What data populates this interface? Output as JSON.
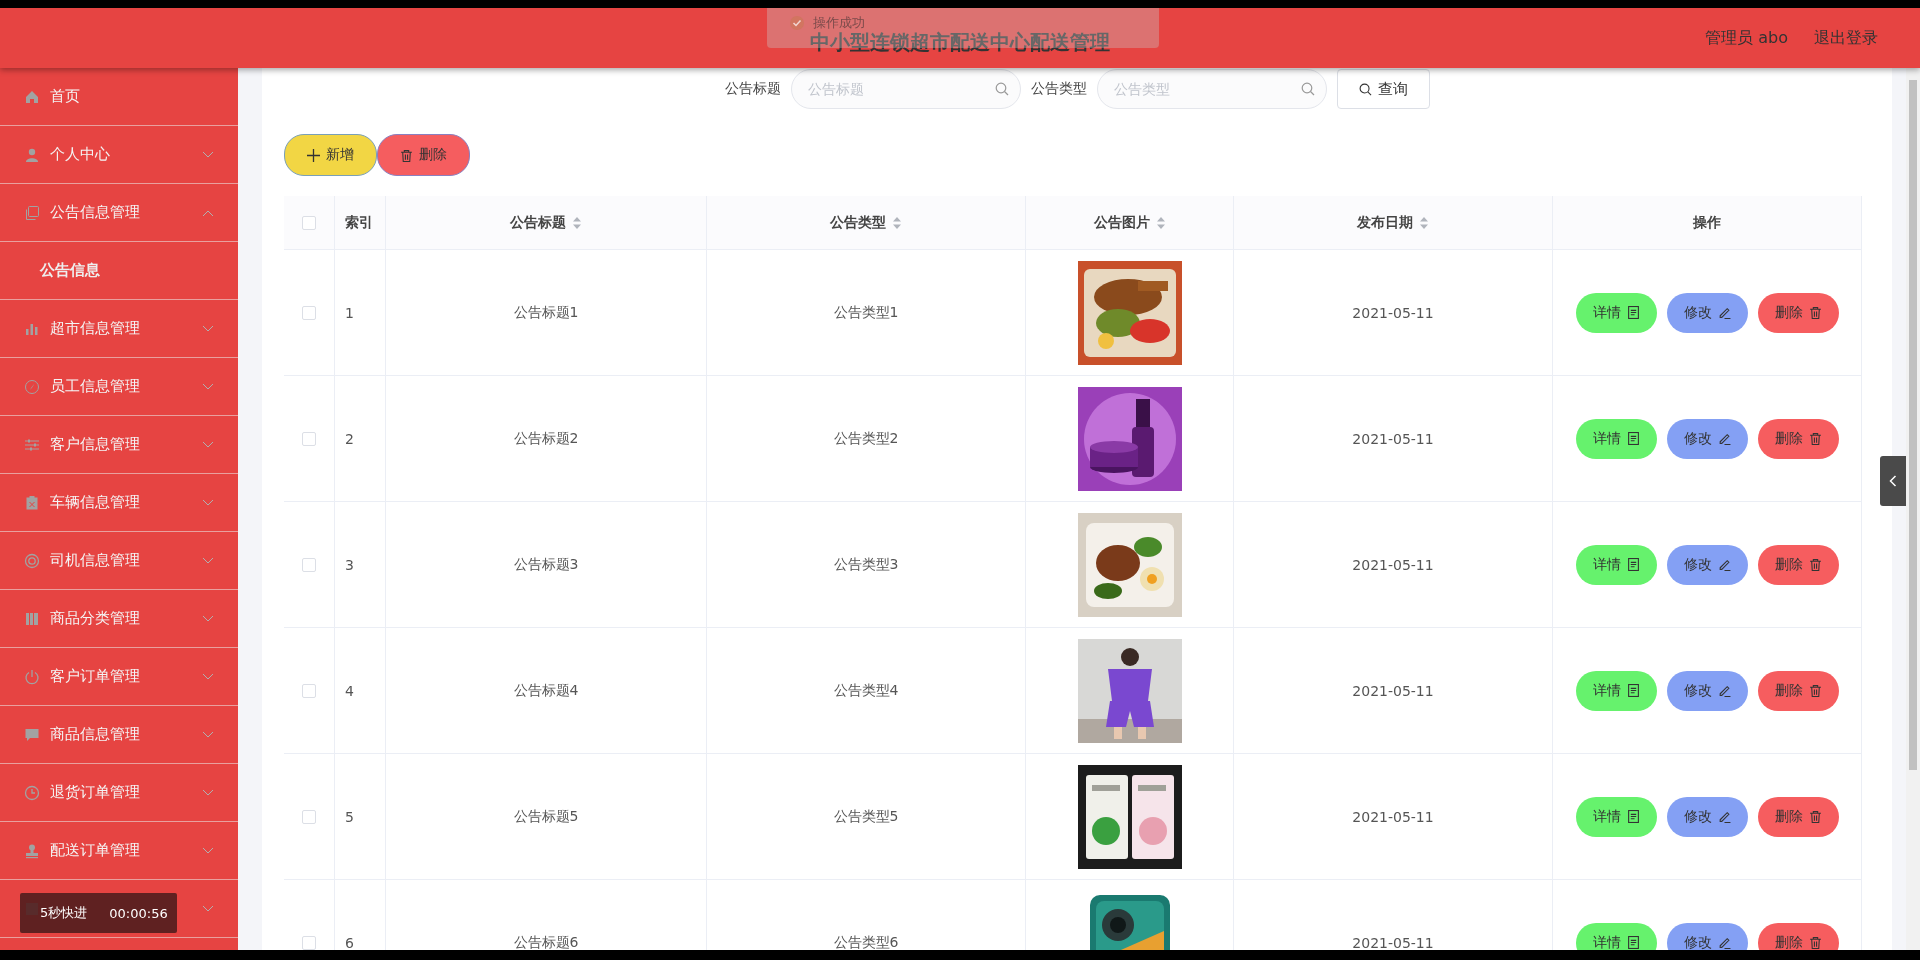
{
  "header": {
    "title": "中小型连锁超市配送中心配送管理",
    "user": "管理员 abo",
    "logout": "退出登录"
  },
  "toast": {
    "text": "操作成功"
  },
  "sidebar": {
    "items": [
      {
        "label": "首页",
        "kind": "link"
      },
      {
        "label": "个人中心",
        "kind": "submenu",
        "expanded": false
      },
      {
        "label": "公告信息管理",
        "kind": "submenu",
        "expanded": true,
        "children": [
          {
            "label": "公告信息",
            "selected": true
          }
        ]
      },
      {
        "label": "超市信息管理",
        "kind": "submenu",
        "expanded": false
      },
      {
        "label": "员工信息管理",
        "kind": "submenu",
        "expanded": false
      },
      {
        "label": "客户信息管理",
        "kind": "submenu",
        "expanded": false
      },
      {
        "label": "车辆信息管理",
        "kind": "submenu",
        "expanded": false
      },
      {
        "label": "司机信息管理",
        "kind": "submenu",
        "expanded": false
      },
      {
        "label": "商品分类管理",
        "kind": "submenu",
        "expanded": false
      },
      {
        "label": "客户订单管理",
        "kind": "submenu",
        "expanded": false
      },
      {
        "label": "商品信息管理",
        "kind": "submenu",
        "expanded": false
      },
      {
        "label": "退货订单管理",
        "kind": "submenu",
        "expanded": false
      },
      {
        "label": "配送订单管理",
        "kind": "submenu",
        "expanded": false
      },
      {
        "kind": "submenu",
        "expanded": false
      }
    ]
  },
  "search": {
    "fields": [
      {
        "label": "公告标题",
        "placeholder": "公告标题"
      },
      {
        "label": "公告类型",
        "placeholder": "公告类型"
      }
    ],
    "button": "查询"
  },
  "actions": [
    {
      "label": "新增",
      "kind": "add"
    },
    {
      "label": "删除",
      "kind": "delete"
    }
  ],
  "table": {
    "select_all": {
      "checked": false
    },
    "columns": [
      {
        "label": "索引",
        "sortable": false
      },
      {
        "label": "公告标题",
        "sortable": true
      },
      {
        "label": "公告类型",
        "sortable": true
      },
      {
        "label": "公告图片",
        "sortable": true
      },
      {
        "label": "发布日期",
        "sortable": true
      },
      {
        "label": "操作",
        "sortable": false
      }
    ],
    "rows": [
      {
        "checked": false,
        "index": "1",
        "title": "公告标题1",
        "type": "公告类型1",
        "date": "2021-05-11",
        "buttons": [
          {
            "label": "详情",
            "kind": "detail"
          },
          {
            "label": "修改",
            "kind": "edit"
          },
          {
            "label": "删除",
            "kind": "delete"
          }
        ]
      },
      {
        "checked": false,
        "index": "2",
        "title": "公告标题2",
        "type": "公告类型2",
        "date": "2021-05-11",
        "buttons": [
          {
            "label": "详情",
            "kind": "detail"
          },
          {
            "label": "修改",
            "kind": "edit"
          },
          {
            "label": "删除",
            "kind": "delete"
          }
        ]
      },
      {
        "checked": false,
        "index": "3",
        "title": "公告标题3",
        "type": "公告类型3",
        "date": "2021-05-11",
        "buttons": [
          {
            "label": "详情",
            "kind": "detail"
          },
          {
            "label": "修改",
            "kind": "edit"
          },
          {
            "label": "删除",
            "kind": "delete"
          }
        ]
      },
      {
        "checked": false,
        "index": "4",
        "title": "公告标题4",
        "type": "公告类型4",
        "date": "2021-05-11",
        "buttons": [
          {
            "label": "详情",
            "kind": "detail"
          },
          {
            "label": "修改",
            "kind": "edit"
          },
          {
            "label": "删除",
            "kind": "delete"
          }
        ]
      },
      {
        "checked": false,
        "index": "5",
        "title": "公告标题5",
        "type": "公告类型5",
        "date": "2021-05-11",
        "buttons": [
          {
            "label": "详情",
            "kind": "detail"
          },
          {
            "label": "修改",
            "kind": "edit"
          },
          {
            "label": "删除",
            "kind": "delete"
          }
        ]
      },
      {
        "checked": false,
        "index": "6",
        "title": "公告标题6",
        "type": "公告类型6",
        "date": "2021-05-11",
        "buttons": [
          {
            "label": "详情",
            "kind": "detail"
          },
          {
            "label": "修改",
            "kind": "edit"
          },
          {
            "label": "删除",
            "kind": "delete"
          }
        ]
      }
    ]
  },
  "player": {
    "label": "5秒快进",
    "time": "00:00:56"
  }
}
